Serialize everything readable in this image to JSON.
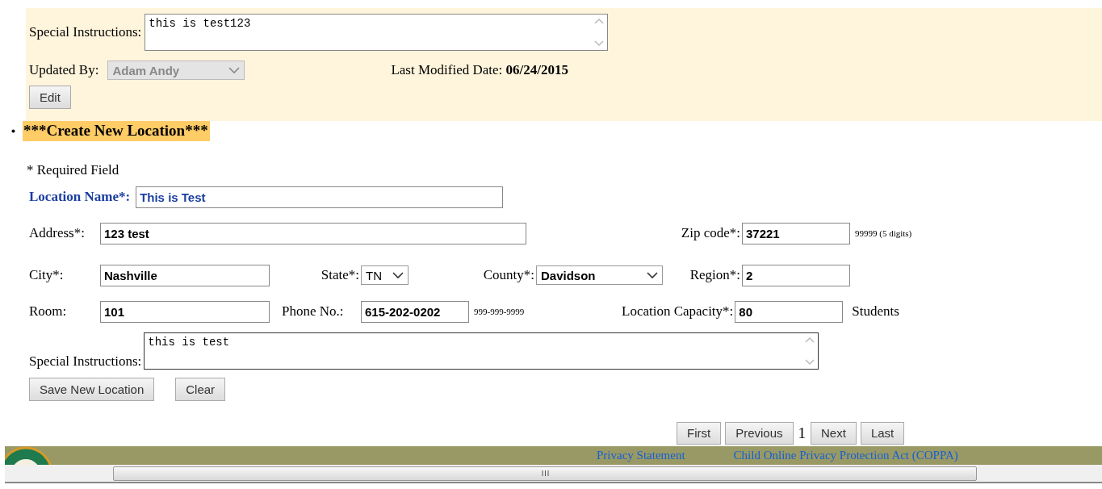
{
  "top_panel": {
    "special_instructions": {
      "label": "Special Instructions:",
      "value": "this is test123"
    },
    "updated_by": {
      "label": "Updated By:",
      "value": "Adam Andy",
      "disabled": true
    },
    "last_modified": {
      "label": "Last Modified Date:",
      "value": "06/24/2015"
    },
    "edit_button": "Edit"
  },
  "section_title": "***Create New Location***",
  "required_note": "* Required Field",
  "form": {
    "location_name": {
      "label": "Location Name*:",
      "value": "This is Test"
    },
    "address": {
      "label": "Address*:",
      "value": "123 test"
    },
    "zip_code": {
      "label": "Zip code*:",
      "value": "37221",
      "hint": "99999 (5 digits)"
    },
    "city": {
      "label": "City*:",
      "value": "Nashville"
    },
    "state": {
      "label": "State*:",
      "value": "TN"
    },
    "county": {
      "label": "County*:",
      "value": "Davidson"
    },
    "region": {
      "label": "Region*:",
      "value": "2"
    },
    "room": {
      "label": "Room:",
      "value": "101"
    },
    "phone": {
      "label": "Phone No.:",
      "value": "615-202-0202",
      "hint": "999-999-9999"
    },
    "capacity": {
      "label": "Location Capacity*:",
      "value": "80",
      "unit": "Students"
    },
    "special_instructions": {
      "label": "Special Instructions:",
      "value": "this is test"
    }
  },
  "buttons": [
    "Save New Location",
    "Clear"
  ],
  "pagination": {
    "before": [
      "First",
      "Previous"
    ],
    "page": "1",
    "after": [
      "Next",
      "Last"
    ]
  },
  "footer": {
    "links": [
      "Privacy Statement",
      "Child Online Privacy Protection Act (COPPA)"
    ]
  }
}
